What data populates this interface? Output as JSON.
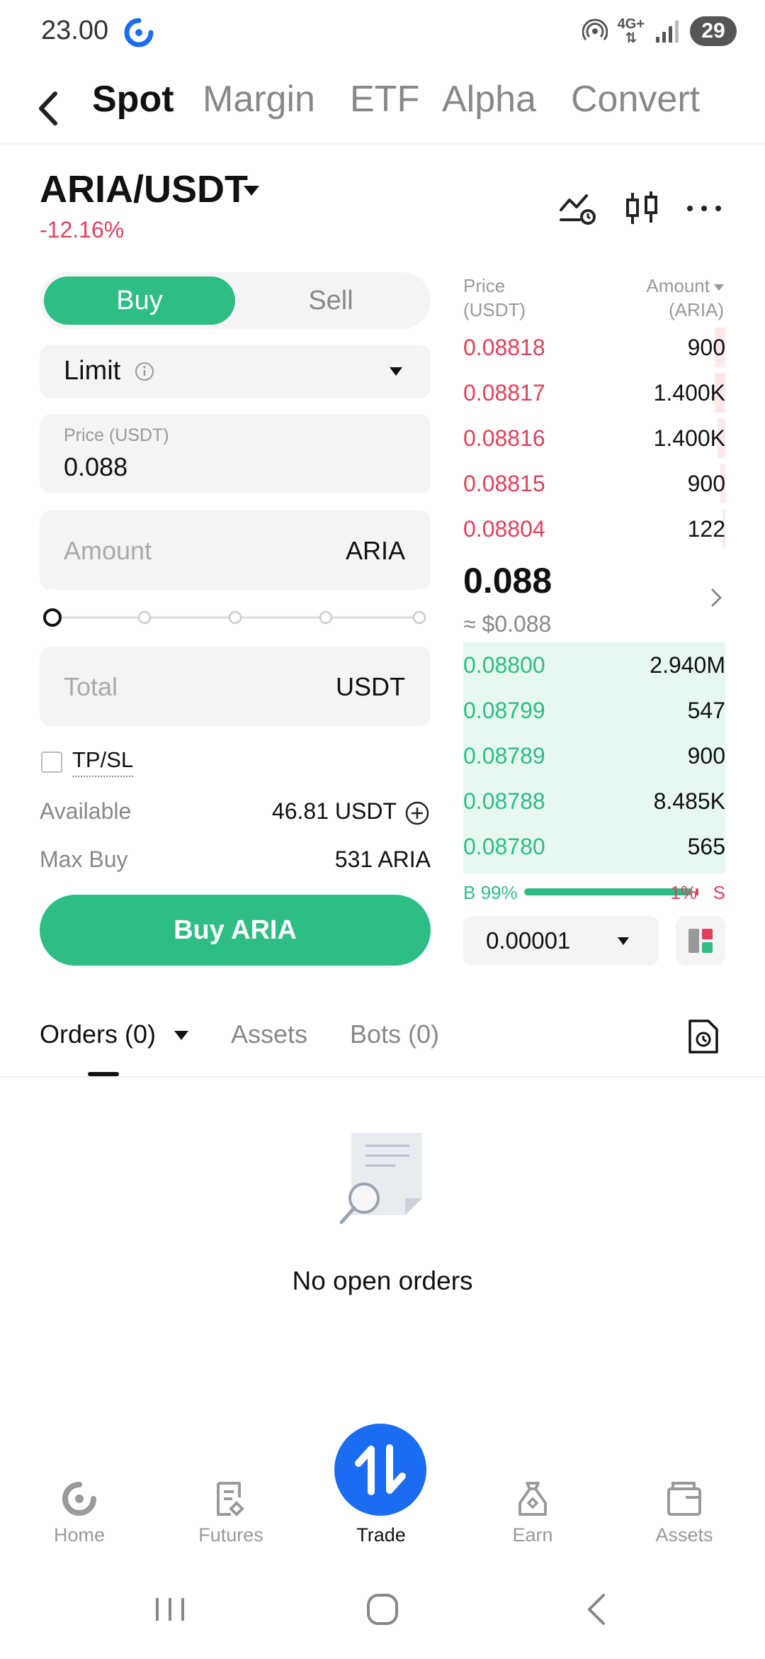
{
  "status_bar": {
    "time": "23.00",
    "network": "4G+",
    "battery": "29"
  },
  "top_tabs": [
    "Spot",
    "Margin",
    "ETF",
    "Alpha",
    "Convert"
  ],
  "pair": {
    "symbol": "ARIA/USDT",
    "change": "-12.16%"
  },
  "trade_form": {
    "buy_label": "Buy",
    "sell_label": "Sell",
    "order_type": "Limit",
    "price_label": "Price (USDT)",
    "price_value": "0.088",
    "amount_placeholder": "Amount",
    "amount_unit": "ARIA",
    "slider_fraction": 0,
    "total_placeholder": "Total",
    "total_unit": "USDT",
    "tpsl_label": "TP/SL",
    "available_label": "Available",
    "available_value": "46.81 USDT",
    "max_buy_label": "Max Buy",
    "max_buy_value": "531 ARIA",
    "submit_label": "Buy ARIA"
  },
  "order_book": {
    "price_header": "Price",
    "price_header_unit": "(USDT)",
    "amount_header": "Amount",
    "amount_header_unit": "(ARIA)",
    "asks": [
      {
        "price": "0.08818",
        "amount": "900",
        "depth": 0.04
      },
      {
        "price": "0.08817",
        "amount": "1.400K",
        "depth": 0.04
      },
      {
        "price": "0.08816",
        "amount": "1.400K",
        "depth": 0.03
      },
      {
        "price": "0.08815",
        "amount": "900",
        "depth": 0.02
      },
      {
        "price": "0.08804",
        "amount": "122",
        "depth": 0.01
      }
    ],
    "last_price": "0.088",
    "last_price_usd": "≈ $0.088",
    "bids": [
      {
        "price": "0.08800",
        "amount": "2.940M"
      },
      {
        "price": "0.08799",
        "amount": "547"
      },
      {
        "price": "0.08789",
        "amount": "900"
      },
      {
        "price": "0.08788",
        "amount": "8.485K"
      },
      {
        "price": "0.08780",
        "amount": "565"
      }
    ],
    "buy_ratio_label": "B 99%",
    "sell_ratio_label": "1%",
    "sell_letter": "S",
    "buy_ratio": 0.99,
    "precision": "0.00001"
  },
  "orders_section": {
    "tabs": [
      "Orders (0)",
      "Assets",
      "Bots (0)"
    ],
    "empty_text": "No open orders"
  },
  "bottom_nav": {
    "items": [
      "Home",
      "Futures",
      "Trade",
      "Earn",
      "Assets"
    ],
    "active": "Trade"
  },
  "colors": {
    "buy_green": "#2ebd85",
    "sell_red": "#e0405a",
    "brand_blue": "#1a6cf0"
  }
}
